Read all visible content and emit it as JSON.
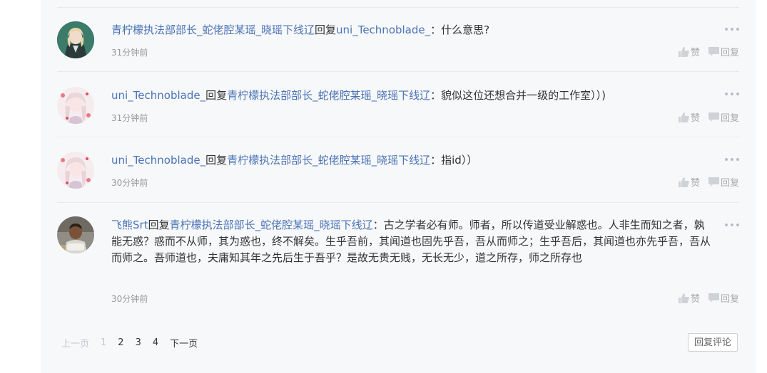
{
  "comments": [
    {
      "author": "青柠檬执法部部长_蛇佬腔某瑶_晓瑶下线辽",
      "reply_word": "回复",
      "target": "uni_Technoblade_",
      "separator": "：",
      "text": "什么意思?",
      "time": "31分钟前",
      "like_label": "赞",
      "reply_label": "回复"
    },
    {
      "author": "uni_Technoblade_",
      "reply_word": "回复",
      "target": "青柠檬执法部部长_蛇佬腔某瑶_晓瑶下线辽",
      "separator": "：",
      "text": "貌似这位还想合并一级的工作室））)",
      "time": "31分钟前",
      "like_label": "赞",
      "reply_label": "回复"
    },
    {
      "author": "uni_Technoblade_",
      "reply_word": "回复",
      "target": "青柠檬执法部部长_蛇佬腔某瑶_晓瑶下线辽",
      "separator": "：",
      "text": "指id））",
      "time": "30分钟前",
      "like_label": "赞",
      "reply_label": "回复"
    },
    {
      "author": "飞熊Srt",
      "reply_word": "回复",
      "target": "青柠檬执法部部长_蛇佬腔某瑶_晓瑶下线辽",
      "separator": "：",
      "text": "古之学者必有师。师者，所以传道受业解惑也。人非生而知之者，孰能无惑？惑而不从师，其为惑也，终不解矣。生乎吾前，其闻道也固先乎吾，吾从而师之；生乎吾后，其闻道也亦先乎吾，吾从而师之。吾师道也，夫庸知其年之先后生于吾乎？是故无贵无贱，无长无少，道之所存，师之所存也",
      "time": "30分钟前",
      "like_label": "赞",
      "reply_label": "回复"
    }
  ],
  "pagination": {
    "prev": "上一页",
    "pages": [
      "1",
      "2",
      "3",
      "4"
    ],
    "current": "1",
    "next": "下一页"
  },
  "reply_comment_button": "回复评论",
  "icons": {
    "more": "more-dots-icon",
    "like": "thumbs-up-icon",
    "reply": "speech-bubble-icon"
  },
  "colors": {
    "link": "#4a73b5",
    "text": "#333333",
    "muted": "#999999",
    "panel": "#f7f8fa"
  }
}
